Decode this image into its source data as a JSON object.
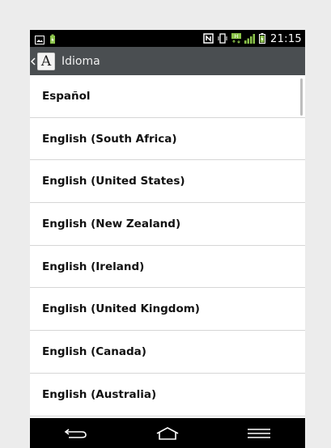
{
  "status_bar": {
    "time": "21:15",
    "icons": [
      "image-icon",
      "battery-saver-icon",
      "nfc-icon",
      "vibrate-icon",
      "data-h-icon",
      "signal-icon",
      "battery-icon"
    ]
  },
  "action_bar": {
    "title": "Idioma",
    "app_icon_letter": "A"
  },
  "languages": [
    "Español",
    "English (South Africa)",
    "English (United States)",
    "English (New Zealand)",
    "English (Ireland)",
    "English (United Kingdom)",
    "English (Canada)",
    "English (Australia)"
  ],
  "colors": {
    "action_bar": "#4a4e51",
    "status_bar": "#000000",
    "accent_green": "#8bc34a"
  }
}
